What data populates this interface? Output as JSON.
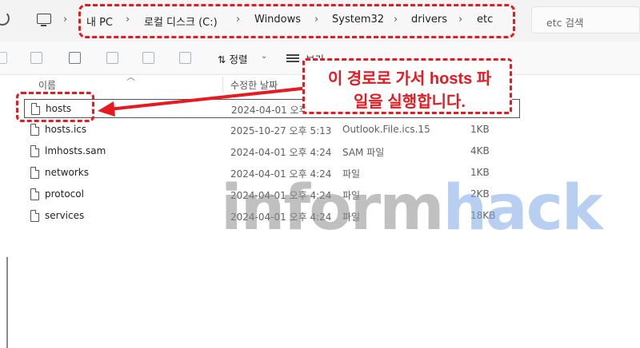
{
  "address_bar": {
    "breadcrumbs": [
      "내 PC",
      "로컬 디스크 (C:)",
      "Windows",
      "System32",
      "drivers",
      "etc"
    ]
  },
  "search": {
    "placeholder": "etc 검색"
  },
  "toolbar": {
    "sort_label": "정렬",
    "view_label": "보기"
  },
  "columns": {
    "name": "이름",
    "date_modified": "수정한 날짜"
  },
  "files": [
    {
      "name": "hosts",
      "date": "2024-04-01 오후 4:24",
      "type": "",
      "size": ""
    },
    {
      "name": "hosts.ics",
      "date": "2025-10-27 오후 5:13",
      "type": "Outlook.File.ics.15",
      "size": "1KB"
    },
    {
      "name": "lmhosts.sam",
      "date": "2024-04-01 오후 4:24",
      "type": "SAM 파일",
      "size": "4KB"
    },
    {
      "name": "networks",
      "date": "2024-04-01 오후 4:24",
      "type": "파일",
      "size": "1KB"
    },
    {
      "name": "protocol",
      "date": "2024-04-01 오후 4:24",
      "type": "파일",
      "size": "2KB"
    },
    {
      "name": "services",
      "date": "2024-04-01 오후 4:24",
      "type": "파일",
      "size": "18KB"
    }
  ],
  "annotation": {
    "line1": "이 경로로 가서 hosts 파",
    "line2": "일을 실행합니다."
  },
  "watermark": {
    "part1": "inform",
    "part2": "hack"
  },
  "colors": {
    "highlight_red": "#e8191f",
    "watermark_blue": "#7fa8e6"
  }
}
